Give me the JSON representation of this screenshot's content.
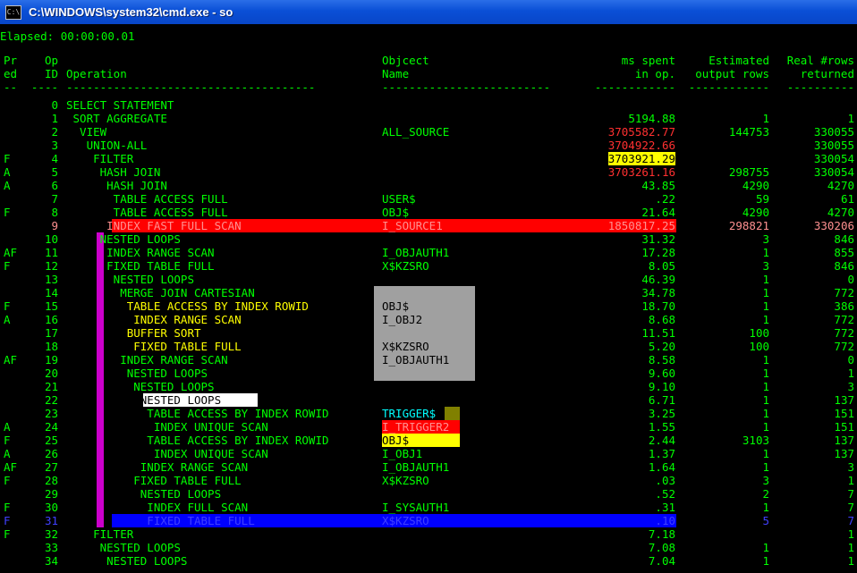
{
  "window": {
    "title": "C:\\WINDOWS\\system32\\cmd.exe - so",
    "icon": "console-icon"
  },
  "elapsed": "Elapsed: 00:00:00.01",
  "headers": {
    "line1": {
      "pred": "Pr",
      "opid": "Op",
      "oper": "",
      "obj": "Objcect",
      "ms": "ms spent",
      "est": "Estimated",
      "real": "Real #rows"
    },
    "line2": {
      "pred": "ed",
      "opid": "ID",
      "oper": "Operation",
      "obj": "Name",
      "ms": "in op.",
      "est": "output rows",
      "real": "returned"
    },
    "line3": {
      "pred": "--",
      "opid": "----",
      "oper": "-------------------------------------",
      "obj": "-------------------------",
      "ms": "------------",
      "est": "------------",
      "real": "----------"
    }
  },
  "rows": [
    {
      "pred": "",
      "id": "0",
      "op": "SELECT STATEMENT",
      "obj": "",
      "ms": "",
      "est": "",
      "real": ""
    },
    {
      "pred": "",
      "id": "1",
      "op": " SORT AGGREGATE",
      "obj": "",
      "ms": "5194.88",
      "est": "1",
      "real": "1"
    },
    {
      "pred": "",
      "id": "2",
      "op": "  VIEW",
      "obj": "ALL_SOURCE",
      "ms": "3705582.77",
      "est": "144753",
      "real": "330055"
    },
    {
      "pred": "",
      "id": "3",
      "op": "   UNION-ALL",
      "obj": "",
      "ms": "3704922.66",
      "est": "",
      "real": "330055"
    },
    {
      "pred": "F",
      "id": "4",
      "op": "    FILTER",
      "obj": "",
      "ms": "3703921.29",
      "est": "",
      "real": "330054"
    },
    {
      "pred": "A",
      "id": "5",
      "op": "     HASH JOIN",
      "obj": "",
      "ms": "3703261.16",
      "est": "298755",
      "real": "330054"
    },
    {
      "pred": "A",
      "id": "6",
      "op": "      HASH JOIN",
      "obj": "",
      "ms": "43.85",
      "est": "4290",
      "real": "4270"
    },
    {
      "pred": "",
      "id": "7",
      "op": "       TABLE ACCESS FULL",
      "obj": "USER$",
      "ms": ".22",
      "est": "59",
      "real": "61"
    },
    {
      "pred": "F",
      "id": "8",
      "op": "       TABLE ACCESS FULL",
      "obj": "OBJ$",
      "ms": "21.64",
      "est": "4290",
      "real": "4270"
    },
    {
      "pred": "",
      "id": "9",
      "op": "      INDEX FAST FULL SCAN",
      "obj": "I_SOURCE1",
      "ms": "1850817.25",
      "est": "298821",
      "real": "330206"
    },
    {
      "pred": "",
      "id": "10",
      "op": "     NESTED LOOPS",
      "obj": "",
      "ms": "31.32",
      "est": "3",
      "real": "846"
    },
    {
      "pred": "AF",
      "id": "11",
      "op": "      INDEX RANGE SCAN",
      "obj": "I_OBJAUTH1",
      "ms": "17.28",
      "est": "1",
      "real": "855"
    },
    {
      "pred": "F",
      "id": "12",
      "op": "      FIXED TABLE FULL",
      "obj": "X$KZSRO",
      "ms": "8.05",
      "est": "3",
      "real": "846"
    },
    {
      "pred": "",
      "id": "13",
      "op": "       NESTED LOOPS",
      "obj": "",
      "ms": "46.39",
      "est": "1",
      "real": "0"
    },
    {
      "pred": "",
      "id": "14",
      "op": "        MERGE JOIN CARTESIAN",
      "obj": "",
      "ms": "34.78",
      "est": "1",
      "real": "772"
    },
    {
      "pred": "F",
      "id": "15",
      "op": "         TABLE ACCESS BY INDEX ROWID",
      "obj": "OBJ$",
      "ms": "18.70",
      "est": "1",
      "real": "386"
    },
    {
      "pred": "A",
      "id": "16",
      "op": "          INDEX RANGE SCAN",
      "obj": "I_OBJ2",
      "ms": "8.68",
      "est": "1",
      "real": "772"
    },
    {
      "pred": "",
      "id": "17",
      "op": "         BUFFER SORT",
      "obj": "",
      "ms": "11.51",
      "est": "100",
      "real": "772"
    },
    {
      "pred": "",
      "id": "18",
      "op": "          FIXED TABLE FULL",
      "obj": "X$KZSRO",
      "ms": "5.20",
      "est": "100",
      "real": "772"
    },
    {
      "pred": "AF",
      "id": "19",
      "op": "        INDEX RANGE SCAN",
      "obj": "I_OBJAUTH1",
      "ms": "8.58",
      "est": "1",
      "real": "0"
    },
    {
      "pred": "",
      "id": "20",
      "op": "         NESTED LOOPS",
      "obj": "",
      "ms": "9.60",
      "est": "1",
      "real": "1"
    },
    {
      "pred": "",
      "id": "21",
      "op": "          NESTED LOOPS",
      "obj": "",
      "ms": "9.10",
      "est": "1",
      "real": "3"
    },
    {
      "pred": "",
      "id": "22",
      "op": "           NESTED LOOPS",
      "obj": "",
      "ms": "6.71",
      "est": "1",
      "real": "137"
    },
    {
      "pred": "",
      "id": "23",
      "op": "            TABLE ACCESS BY INDEX ROWID",
      "obj": "TRIGGER$",
      "ms": "3.25",
      "est": "1",
      "real": "151"
    },
    {
      "pred": "A",
      "id": "24",
      "op": "             INDEX UNIQUE SCAN",
      "obj": "I_TRIGGER2",
      "ms": "1.55",
      "est": "1",
      "real": "151"
    },
    {
      "pred": "F",
      "id": "25",
      "op": "            TABLE ACCESS BY INDEX ROWID",
      "obj": "OBJ$",
      "ms": "2.44",
      "est": "3103",
      "real": "137"
    },
    {
      "pred": "A",
      "id": "26",
      "op": "             INDEX UNIQUE SCAN",
      "obj": "I_OBJ1",
      "ms": "1.37",
      "est": "1",
      "real": "137"
    },
    {
      "pred": "AF",
      "id": "27",
      "op": "           INDEX RANGE SCAN",
      "obj": "I_OBJAUTH1",
      "ms": "1.64",
      "est": "1",
      "real": "3"
    },
    {
      "pred": "F",
      "id": "28",
      "op": "          FIXED TABLE FULL",
      "obj": "X$KZSRO",
      "ms": ".03",
      "est": "3",
      "real": "1"
    },
    {
      "pred": "",
      "id": "29",
      "op": "           NESTED LOOPS",
      "obj": "",
      "ms": ".52",
      "est": "2",
      "real": "7"
    },
    {
      "pred": "F",
      "id": "30",
      "op": "            INDEX FULL SCAN",
      "obj": "I_SYSAUTH1",
      "ms": ".31",
      "est": "1",
      "real": "7"
    },
    {
      "pred": "F",
      "id": "31",
      "op": "            FIXED TABLE FULL",
      "obj": "X$KZSRO",
      "ms": ".10",
      "est": "5",
      "real": "7"
    },
    {
      "pred": "F",
      "id": "32",
      "op": "    FILTER",
      "obj": "",
      "ms": "7.18",
      "est": "",
      "real": "1"
    },
    {
      "pred": "",
      "id": "33",
      "op": "     NESTED LOOPS",
      "obj": "",
      "ms": "7.08",
      "est": "1",
      "real": "1"
    },
    {
      "pred": "",
      "id": "34",
      "op": "      NESTED LOOPS",
      "obj": "",
      "ms": "7.04",
      "est": "1",
      "real": "1"
    }
  ],
  "colors": {
    "console_bg": "#000000",
    "console_text": "#00ff00",
    "highlight_red": "#ff0000",
    "highlight_yellow": "#ffff00",
    "highlight_blue": "#0000ff",
    "highlight_magenta": "#cc00cc",
    "highlight_gray": "#a0a0a0",
    "titlebar": "#0a4fd6"
  }
}
